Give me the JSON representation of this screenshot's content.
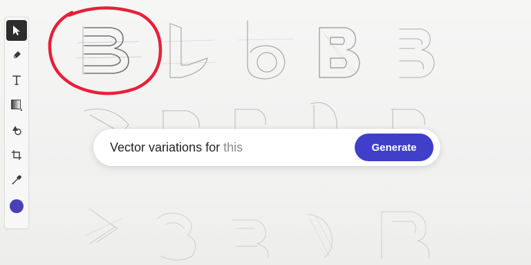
{
  "prompt": {
    "label": "Vector variations for",
    "placeholder": "this",
    "generate_label": "Generate"
  },
  "toolbar": {
    "tools": [
      {
        "name": "select-tool",
        "icon": "arrow-pointer-icon",
        "active": true
      },
      {
        "name": "pen-tool",
        "icon": "pen-nib-icon",
        "active": false
      },
      {
        "name": "type-tool",
        "icon": "text-T-icon",
        "active": false
      },
      {
        "name": "gradient-tool",
        "icon": "gradient-square-icon",
        "active": false
      },
      {
        "name": "shapes-tool",
        "icon": "shapes-icon",
        "active": false
      },
      {
        "name": "crop-tool",
        "icon": "crop-icon",
        "active": false
      },
      {
        "name": "eyedropper-tool",
        "icon": "eyedropper-icon",
        "active": false
      }
    ],
    "color_swatch": "#4a3fb5"
  },
  "colors": {
    "accent": "#3f3fc9",
    "highlight_circle": "#e8203a",
    "sketch_stroke": "#8c8c8c"
  }
}
